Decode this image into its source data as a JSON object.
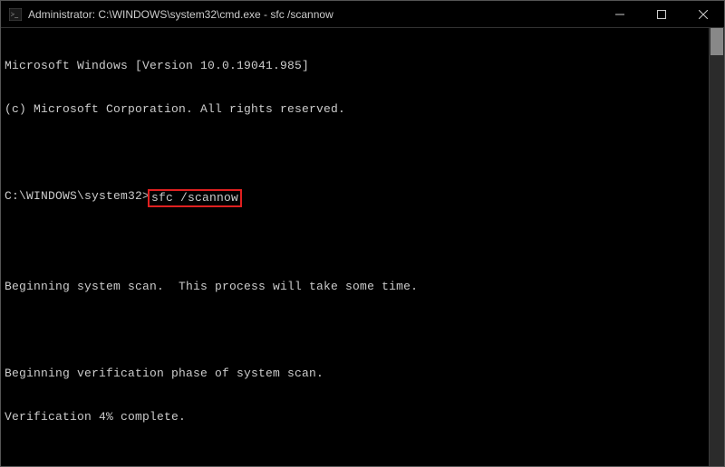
{
  "titlebar": {
    "title": "Administrator: C:\\WINDOWS\\system32\\cmd.exe - sfc  /scannow"
  },
  "terminal": {
    "line1": "Microsoft Windows [Version 10.0.19041.985]",
    "line2": "(c) Microsoft Corporation. All rights reserved.",
    "blank1": "",
    "prompt_path": "C:\\WINDOWS\\system32>",
    "command": "sfc /scannow",
    "blank2": "",
    "scan_msg": "Beginning system scan.  This process will take some time.",
    "blank3": "",
    "verify_msg": "Beginning verification phase of system scan.",
    "progress_msg": "Verification 4% complete."
  }
}
